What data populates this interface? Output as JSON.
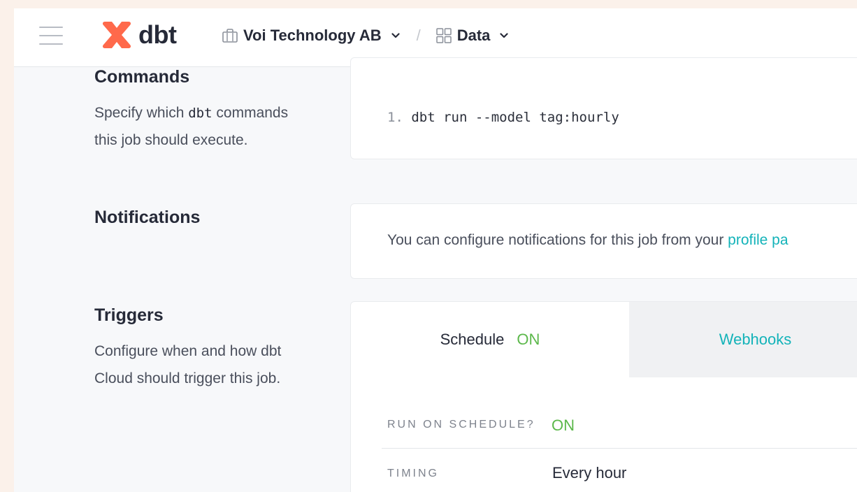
{
  "header": {
    "account": "Voi Technology AB",
    "separator": "/",
    "project": "Data",
    "logo_text": "dbt"
  },
  "commands": {
    "title": "Commands",
    "desc_prefix": "Specify which ",
    "desc_code": "dbt",
    "desc_suffix": " commands this job should execute.",
    "lines": [
      {
        "number": "1.",
        "text": "dbt run --model tag:hourly"
      }
    ]
  },
  "notifications": {
    "title": "Notifications",
    "text": "You can configure notifications for this job from your ",
    "link": "profile pa"
  },
  "triggers": {
    "title": "Triggers",
    "desc": "Configure when and how dbt Cloud should trigger this job.",
    "tabs": {
      "schedule": {
        "label": "Schedule",
        "status": "ON"
      },
      "webhooks": {
        "label": "Webhooks"
      }
    },
    "run_on_schedule": {
      "label": "RUN ON SCHEDULE?",
      "value": "ON"
    },
    "timing": {
      "label": "TIMING",
      "value": "Every hour"
    }
  },
  "colors": {
    "accent_teal": "#13b3b9",
    "on_green": "#5cb84b",
    "brand_orange": "#ff694b"
  },
  "icons": [
    "hamburger-icon",
    "dbt-logo-icon",
    "briefcase-icon",
    "chevron-down-icon",
    "grid-icon"
  ]
}
